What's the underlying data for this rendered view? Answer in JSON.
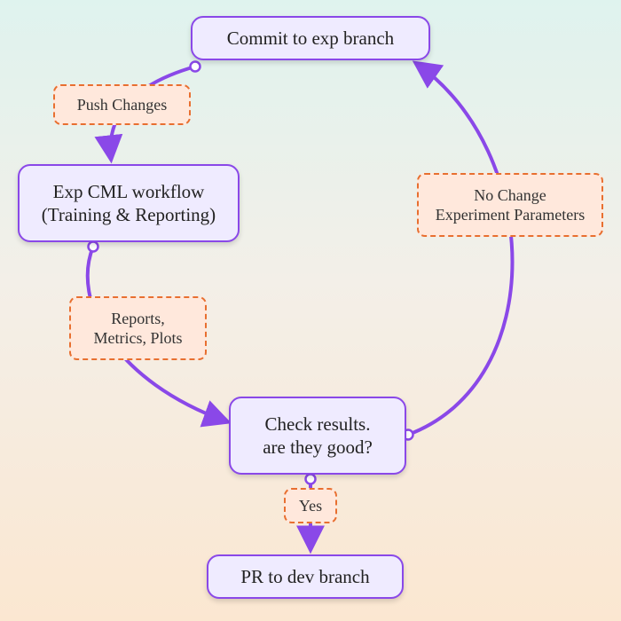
{
  "nodes": {
    "commit": "Commit to exp branch",
    "cml": "Exp CML workflow\n(Training & Reporting)",
    "check": "Check results.\nare they good?",
    "pr": "PR to dev branch"
  },
  "labels": {
    "push": "Push Changes",
    "reports": "Reports,\nMetrics, Plots",
    "nochange": "No Change\nExperiment Parameters",
    "yes": "Yes"
  },
  "colors": {
    "node_border": "#8a48e8",
    "node_fill": "#efebff",
    "label_border": "#e86f30",
    "label_fill": "#ffe8dc"
  },
  "chart_data": {
    "type": "flowchart",
    "nodes": [
      {
        "id": "commit",
        "label": "Commit to exp branch"
      },
      {
        "id": "cml",
        "label": "Exp CML workflow (Training & Reporting)"
      },
      {
        "id": "check",
        "label": "Check results. are they good?"
      },
      {
        "id": "pr",
        "label": "PR to dev branch"
      }
    ],
    "edges": [
      {
        "from": "commit",
        "to": "cml",
        "label": "Push Changes"
      },
      {
        "from": "cml",
        "to": "check",
        "label": "Reports, Metrics, Plots"
      },
      {
        "from": "check",
        "to": "commit",
        "label": "No Change Experiment Parameters"
      },
      {
        "from": "check",
        "to": "pr",
        "label": "Yes"
      }
    ]
  }
}
